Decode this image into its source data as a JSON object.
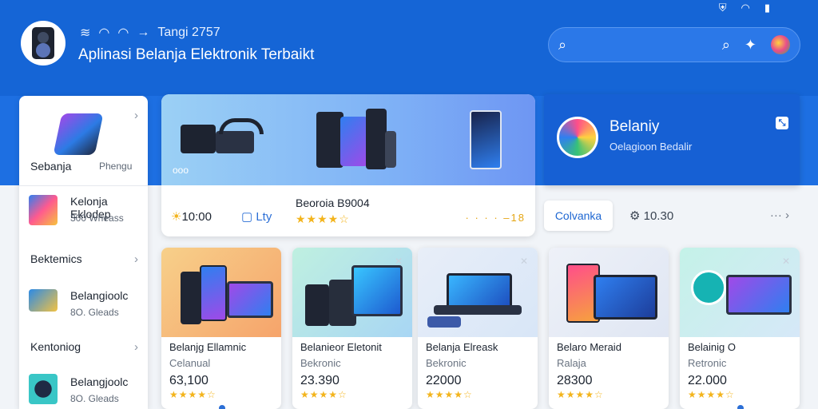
{
  "system": {
    "icons": [
      "shield-icon",
      "wifi-icon",
      "battery-icon"
    ]
  },
  "header": {
    "status": "Tangi 2757",
    "title": "Aplinasi Belanja Elektronik Terbaikt"
  },
  "search": {
    "placeholder": ""
  },
  "sidebar": {
    "feature": {
      "label": "Sebanja",
      "sub": "Phengu"
    },
    "items": [
      {
        "label": "Kelonja Eklodep",
        "sub": "300 Wheass"
      },
      {
        "label": "Bektemics"
      },
      {
        "label": "Belangioolc",
        "sub": "8O. Gleads"
      },
      {
        "label": "Kentoniog"
      },
      {
        "label": "Belangjoolc",
        "sub": "8O. Gleads"
      }
    ]
  },
  "hero": {
    "tag": "ooo",
    "title": "Beoroia B9004",
    "price": "10:00",
    "buy_label": "Lty",
    "rating_count": "18"
  },
  "promo": {
    "title": "Belaniy",
    "subtitle": "Oelagioon Bedalir"
  },
  "actions": {
    "chip_label": "Colvanka",
    "rank": "10.30"
  },
  "products": [
    {
      "name": "Belanjg Ellamnic",
      "category": "Celanual",
      "price": "63,100"
    },
    {
      "name": "Belanieor Eletonit",
      "category": "Bekronic",
      "price": "23.390"
    },
    {
      "name": "Belanja Elreask",
      "category": "Bekronic",
      "price": "22000"
    },
    {
      "name": "Belaro Meraid",
      "category": "Ralaja",
      "price": "28300"
    },
    {
      "name": "Belainig O",
      "category": "Retronic",
      "price": "22.000"
    }
  ],
  "colors": {
    "brand": "#1565d6",
    "accent": "#2c6fd6",
    "star": "#f3b41c"
  }
}
